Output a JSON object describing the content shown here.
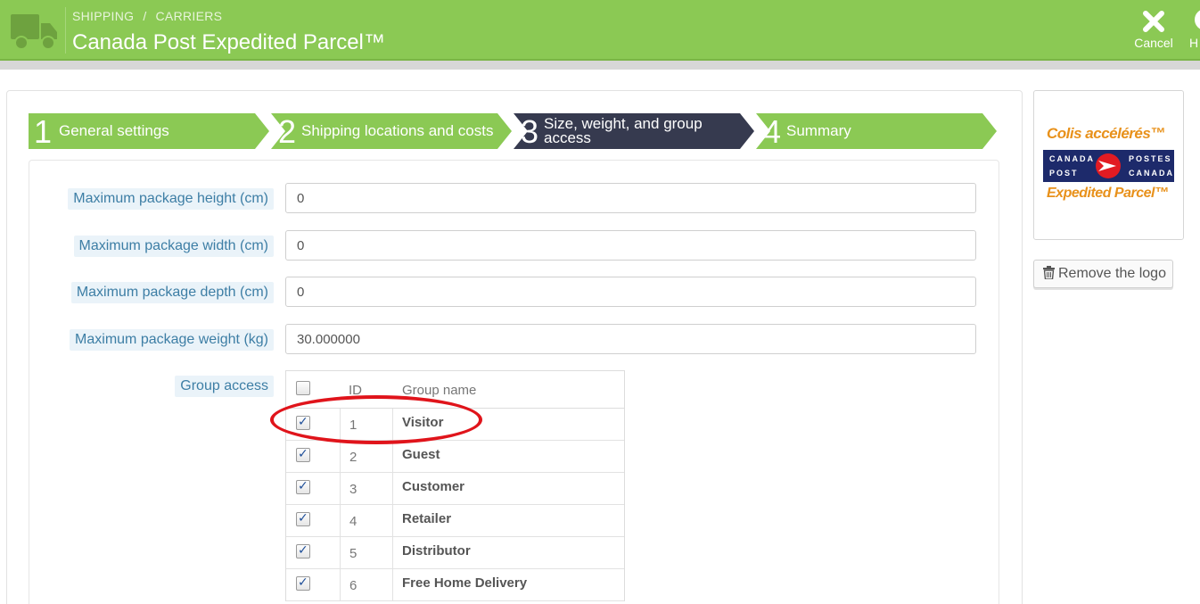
{
  "header": {
    "breadcrumb": [
      "SHIPPING",
      "CARRIERS"
    ],
    "breadcrumb_sep": "/",
    "title": "Canada Post Expedited Parcel™",
    "cancel_label": "Cancel",
    "help_label": "H"
  },
  "steps": [
    {
      "number": "1",
      "label": "General settings",
      "state": "complete"
    },
    {
      "number": "2",
      "label": "Shipping locations and costs",
      "state": "complete"
    },
    {
      "number": "3",
      "label": "Size, weight, and group access",
      "label_line1": "Size, weight, and group",
      "label_line2": "access",
      "state": "current"
    },
    {
      "number": "4",
      "label": "Summary",
      "state": "complete"
    }
  ],
  "form": {
    "max_height": {
      "label": "Maximum package height (cm)",
      "value": "0"
    },
    "max_width": {
      "label": "Maximum package width (cm)",
      "value": "0"
    },
    "max_depth": {
      "label": "Maximum package depth (cm)",
      "value": "0"
    },
    "max_weight": {
      "label": "Maximum package weight (kg)",
      "value": "30.000000"
    },
    "group_access": {
      "label": "Group access",
      "headers": {
        "id": "ID",
        "name": "Group name"
      },
      "select_all_checked": false,
      "rows": [
        {
          "id": "1",
          "name": "Visitor",
          "checked": true
        },
        {
          "id": "2",
          "name": "Guest",
          "checked": true
        },
        {
          "id": "3",
          "name": "Customer",
          "checked": true
        },
        {
          "id": "4",
          "name": "Retailer",
          "checked": true
        },
        {
          "id": "5",
          "name": "Distributor",
          "checked": true
        },
        {
          "id": "6",
          "name": "Free Home Delivery",
          "checked": true
        }
      ]
    }
  },
  "logo": {
    "line_top": "Colis accélérés™",
    "band_left_top": "CANADA",
    "band_left_bottom": "POST",
    "band_right_top": "POSTES",
    "band_right_bottom": "CANADA",
    "line_bottom": "Expedited Parcel™",
    "remove_label": "Remove the logo"
  },
  "colors": {
    "header_green": "#8bc954",
    "step_complete": "#8bc954",
    "step_current": "#363a4f",
    "highlight_ring": "#e0141b"
  }
}
